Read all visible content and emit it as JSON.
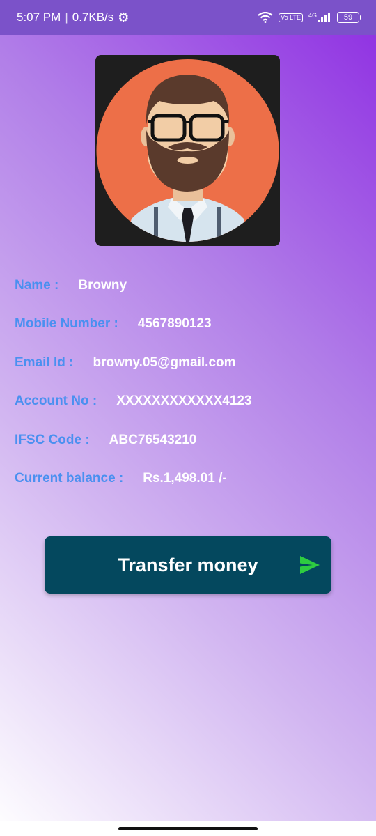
{
  "status_bar": {
    "time": "5:07 PM",
    "separator": "|",
    "speed": "0.7KB/s",
    "lte": "Vo LTE",
    "network": "4G",
    "battery": "59"
  },
  "profile": {
    "avatar_icon": "user-avatar-bearded-man"
  },
  "details": [
    {
      "label": "Name :",
      "value": "Browny"
    },
    {
      "label": "Mobile Number :",
      "value": "4567890123"
    },
    {
      "label": "Email Id :",
      "value": "browny.05@gmail.com"
    },
    {
      "label": "Account No :",
      "value": "XXXXXXXXXXXX4123"
    },
    {
      "label": "IFSC Code :",
      "value": "ABC76543210"
    },
    {
      "label": "Current balance :",
      "value": "Rs.1,498.01 /-"
    }
  ],
  "transfer_button": {
    "label": "Transfer money",
    "icon": "send-icon",
    "icon_color": "#2ecc40"
  },
  "colors": {
    "label": "#4a90f0",
    "value": "#ffffff",
    "button_bg": "#04485e"
  }
}
